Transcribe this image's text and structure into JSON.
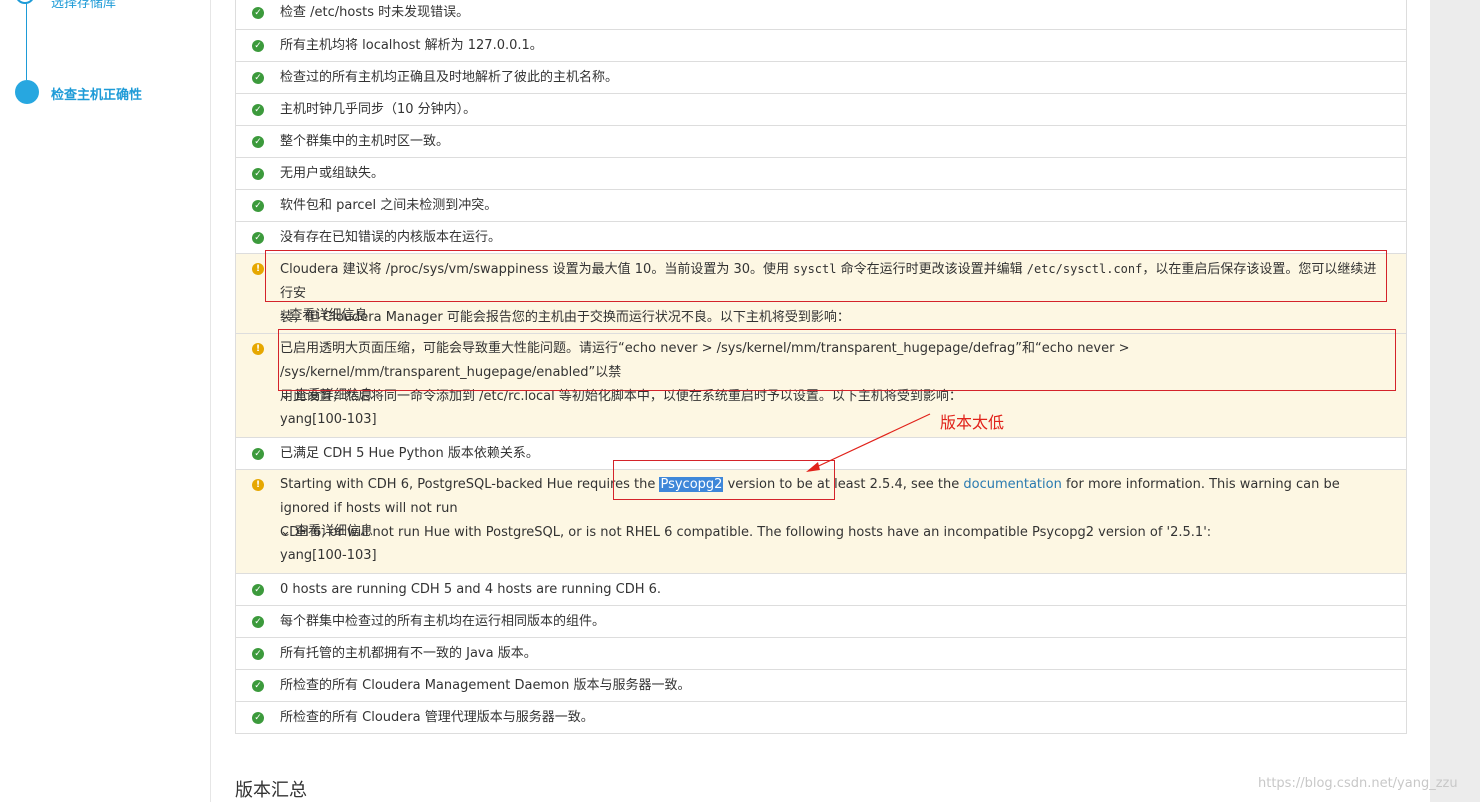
{
  "sidebar": {
    "steps": [
      {
        "label": "选择存储库",
        "state": "done"
      },
      {
        "label": "检查主机正确性",
        "state": "current"
      }
    ]
  },
  "checks": [
    {
      "status": "ok",
      "text": "检查 /etc/hosts 时未发现错误。"
    },
    {
      "status": "ok",
      "text": "所有主机均将 localhost 解析为 127.0.0.1。"
    },
    {
      "status": "ok",
      "text": "检查过的所有主机均正确且及时地解析了彼此的主机名称。"
    },
    {
      "status": "ok",
      "text": "主机时钟几乎同步（10 分钟内）。"
    },
    {
      "status": "ok",
      "text": "整个群集中的主机时区一致。"
    },
    {
      "status": "ok",
      "text": "无用户或组缺失。"
    },
    {
      "status": "ok",
      "text": "软件包和 parcel 之间未检测到冲突。"
    },
    {
      "status": "ok",
      "text": "没有存在已知错误的内核版本在运行。"
    }
  ],
  "warn_swappiness": {
    "p1": "Cloudera 建议将 /proc/sys/vm/swappiness 设置为最大值 10。当前设置为 30。使用 ",
    "cmd1": "sysctl",
    "p2": " 命令在运行时更改该设置并编辑 ",
    "cmd2": "/etc/sysctl.conf",
    "p3": "，以在重启后保存该设置。您可以继续进行安",
    "line2": "装，但 Cloudera Manager 可能会报告您的主机由于交换而运行状况不良。以下主机将受到影响：",
    "detail": "查看详细信息"
  },
  "warn_hugepage": {
    "line1": "已启用透明大页面压缩，可能会导致重大性能问题。请运行“echo never > /sys/kernel/mm/transparent_hugepage/defrag”和“echo never > /sys/kernel/mm/transparent_hugepage/enabled”以禁",
    "line2": "用此设置，然后将同一命令添加到 /etc/rc.local 等初始化脚本中，以便在系统重启时予以设置。以下主机将受到影响：",
    "detail": "查看详细信息",
    "hosts": "yang[100-103]"
  },
  "check_hue": {
    "status": "ok",
    "text": "已满足 CDH 5 Hue Python 版本依赖关系。"
  },
  "warn_psycopg": {
    "p1": "Starting with CDH 6, PostgreSQL-backed Hue requires the ",
    "sel": "Psycopg2",
    "p2": " version to be at least 2.5.4, see the ",
    "link": "documentation",
    "p3": " for more information. This warning can be ignored if hosts will not run",
    "line2": "CDH 6, or will not run Hue with PostgreSQL, or is not RHEL 6 compatible. The following hosts have an incompatible Psycopg2 version of '2.5.1':",
    "detail": "查看详细信息",
    "hosts": "yang[100-103]"
  },
  "checks_tail": [
    {
      "status": "ok",
      "text": "0 hosts are running CDH 5 and 4 hosts are running CDH 6."
    },
    {
      "status": "ok",
      "text": "每个群集中检查过的所有主机均在运行相同版本的组件。"
    },
    {
      "status": "ok",
      "text": "所有托管的主机都拥有不一致的 Java 版本。"
    },
    {
      "status": "ok",
      "text": "所检查的所有 Cloudera Management Daemon 版本与服务器一致。"
    },
    {
      "status": "ok",
      "text": "所检查的所有 Cloudera 管理代理版本与服务器一致。"
    }
  ],
  "annotation": "版本太低",
  "section_title": "版本汇总",
  "watermark": "https://blog.csdn.net/yang_zzu",
  "colors": {
    "ok": "#3c9a3c",
    "warn": "#e6a700",
    "annotation": "#e1221a",
    "accent": "#1e9bd7"
  }
}
